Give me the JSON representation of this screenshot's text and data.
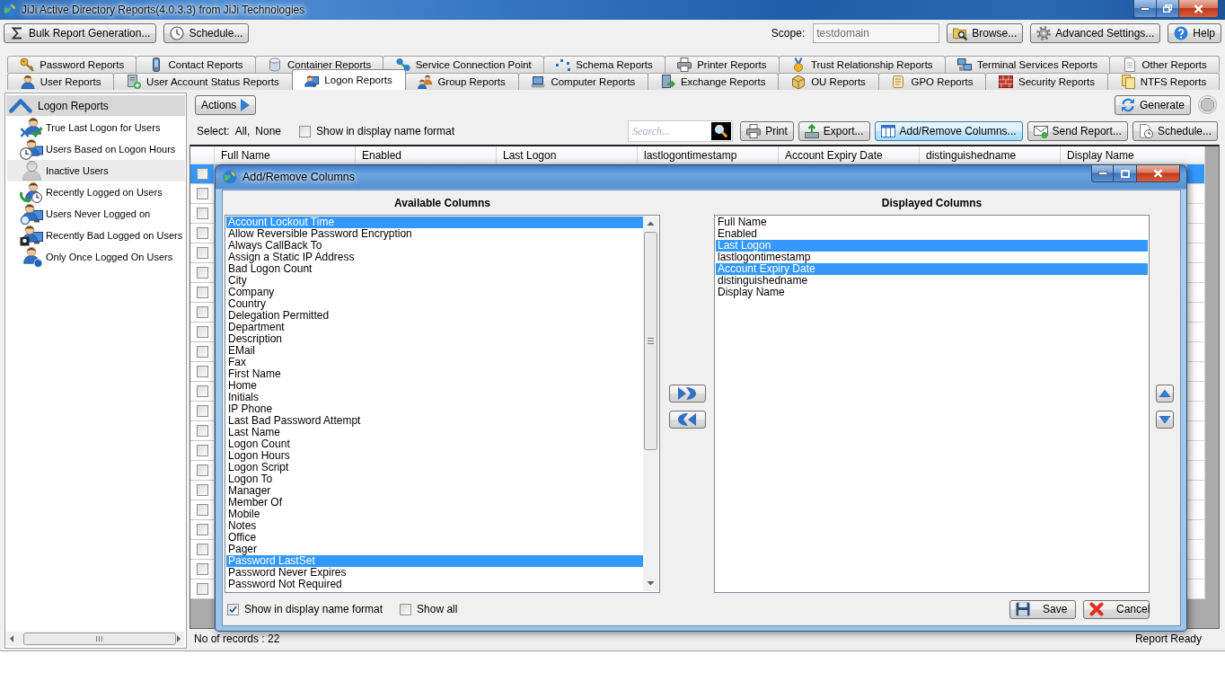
{
  "window": {
    "title": "JiJi Active Directory Reports(4.0.3.3) from JiJi Technologies"
  },
  "toolbar": {
    "left_buttons": [
      "Bulk Report Generation...",
      "Schedule..."
    ],
    "scope": {
      "label": "Scope:",
      "value": "testdomain",
      "disabled": true
    },
    "right_buttons": [
      "Browse...",
      "Advanced Settings...",
      "Help"
    ]
  },
  "tabs": {
    "upper_row": [
      {
        "label": "Password Reports",
        "selected": false
      },
      {
        "label": "Contact Reports",
        "selected": false
      },
      {
        "label": "Container Reports",
        "selected": false
      },
      {
        "label": "Service Connection Point",
        "selected": false
      },
      {
        "label": "Schema Reports",
        "selected": false
      },
      {
        "label": "Printer Reports",
        "selected": false
      },
      {
        "label": "Trust Relationship Reports",
        "selected": false
      },
      {
        "label": "Terminal Services Reports",
        "selected": false
      },
      {
        "label": "Other Reports",
        "selected": false
      }
    ],
    "lower_row": [
      {
        "label": "User Reports",
        "selected": false
      },
      {
        "label": "User Account Status Reports",
        "selected": false
      },
      {
        "label": "Logon Reports",
        "selected": true
      },
      {
        "label": "Group Reports",
        "selected": false
      },
      {
        "label": "Computer Reports",
        "selected": false
      },
      {
        "label": "Exchange Reports",
        "selected": false
      },
      {
        "label": "OU Reports",
        "selected": false
      },
      {
        "label": "GPO Reports",
        "selected": false
      },
      {
        "label": "Security Reports",
        "selected": false
      },
      {
        "label": "NTFS Reports",
        "selected": false
      }
    ]
  },
  "sidebar": {
    "header": "Logon Reports",
    "items": [
      {
        "label": "True Last Logon for Users",
        "selected": false
      },
      {
        "label": "Users Based on Logon Hours",
        "selected": false
      },
      {
        "label": "Inactive Users",
        "selected": true
      },
      {
        "label": "Recently Logged on Users",
        "selected": false
      },
      {
        "label": "Users Never Logged on",
        "selected": false
      },
      {
        "label": "Recently Bad Logged on Users",
        "selected": false
      },
      {
        "label": "Only Once Logged On Users",
        "selected": false
      }
    ]
  },
  "report": {
    "actions_button": "Actions",
    "generate_button": "Generate",
    "stop_button": {
      "disabled": true
    },
    "select": {
      "label": "Select:",
      "links": [
        "All,",
        "None"
      ]
    },
    "display_name_checkbox": {
      "label": "Show in display name format",
      "checked": false
    },
    "search": {
      "placeholder": "Search..."
    },
    "buttons": [
      {
        "label": "Print",
        "highlighted": false
      },
      {
        "label": "Export...",
        "highlighted": false
      },
      {
        "label": "Add/Remove Columns...",
        "highlighted": true
      },
      {
        "label": "Send Report...",
        "highlighted": false
      },
      {
        "label": "Schedule...",
        "highlighted": false
      }
    ]
  },
  "grid": {
    "columns": [
      "Full Name",
      "Enabled",
      "Last Logon",
      "lastlogontimestamp",
      "Account Expiry Date",
      "distinguishedname",
      "Display Name"
    ],
    "rows": [
      {
        "selected": true,
        "checked": false
      },
      {
        "selected": false,
        "checked": false
      },
      {
        "selected": false,
        "checked": false
      },
      {
        "selected": false,
        "checked": false
      },
      {
        "selected": false,
        "checked": false
      },
      {
        "selected": false,
        "checked": false
      },
      {
        "selected": false,
        "checked": false
      },
      {
        "selected": false,
        "checked": false
      },
      {
        "selected": false,
        "checked": false
      },
      {
        "selected": false,
        "checked": false
      },
      {
        "selected": false,
        "checked": false
      },
      {
        "selected": false,
        "checked": false
      },
      {
        "selected": false,
        "checked": false
      },
      {
        "selected": false,
        "checked": false
      },
      {
        "selected": false,
        "checked": false
      },
      {
        "selected": false,
        "checked": false
      },
      {
        "selected": false,
        "checked": false
      },
      {
        "selected": false,
        "checked": false
      },
      {
        "selected": false,
        "checked": false
      },
      {
        "selected": false,
        "checked": false
      },
      {
        "selected": false,
        "checked": false
      },
      {
        "selected": false,
        "checked": false
      }
    ]
  },
  "dialog": {
    "title": "Add/Remove Columns",
    "available": {
      "heading": "Available Columns",
      "items": [
        {
          "label": "Account Lockout Time",
          "selected": true
        },
        {
          "label": "Allow Reversible Password Encryption",
          "selected": false
        },
        {
          "label": "Always CallBack To",
          "selected": false
        },
        {
          "label": "Assign a Static IP Address",
          "selected": false
        },
        {
          "label": "Bad Logon Count",
          "selected": false
        },
        {
          "label": "City",
          "selected": false
        },
        {
          "label": "Company",
          "selected": false
        },
        {
          "label": "Country",
          "selected": false
        },
        {
          "label": "Delegation Permitted",
          "selected": false
        },
        {
          "label": "Department",
          "selected": false
        },
        {
          "label": "Description",
          "selected": false
        },
        {
          "label": "EMail",
          "selected": false
        },
        {
          "label": "Fax",
          "selected": false
        },
        {
          "label": "First Name",
          "selected": false
        },
        {
          "label": "Home",
          "selected": false
        },
        {
          "label": "Initials",
          "selected": false
        },
        {
          "label": "IP Phone",
          "selected": false
        },
        {
          "label": "Last Bad Password Attempt",
          "selected": false
        },
        {
          "label": "Last Name",
          "selected": false
        },
        {
          "label": "Logon Count",
          "selected": false
        },
        {
          "label": "Logon Hours",
          "selected": false
        },
        {
          "label": "Logon Script",
          "selected": false
        },
        {
          "label": "Logon To",
          "selected": false
        },
        {
          "label": "Manager",
          "selected": false
        },
        {
          "label": "Member Of",
          "selected": false
        },
        {
          "label": "Mobile",
          "selected": false
        },
        {
          "label": "Notes",
          "selected": false
        },
        {
          "label": "Office",
          "selected": false
        },
        {
          "label": "Pager",
          "selected": false
        },
        {
          "label": "Password LastSet",
          "selected": true
        },
        {
          "label": "Password Never Expires",
          "selected": false
        },
        {
          "label": "Password Not Required",
          "selected": false
        }
      ]
    },
    "displayed": {
      "heading": "Displayed Columns",
      "items": [
        {
          "label": "Full Name",
          "selected": false
        },
        {
          "label": "Enabled",
          "selected": false
        },
        {
          "label": "Last Logon",
          "selected": true
        },
        {
          "label": "lastlogontimestamp",
          "selected": false
        },
        {
          "label": "Account Expiry Date",
          "selected": true
        },
        {
          "label": "distinguishedname",
          "selected": false
        },
        {
          "label": "Display Name",
          "selected": false
        }
      ]
    },
    "checkboxes": [
      {
        "label": "Show in display name format",
        "checked": true
      },
      {
        "label": "Show all",
        "checked": false
      }
    ],
    "buttons": [
      "Save",
      "Cancel"
    ]
  },
  "status_bar": {
    "records": "No of records : 22",
    "status": "Report Ready"
  }
}
